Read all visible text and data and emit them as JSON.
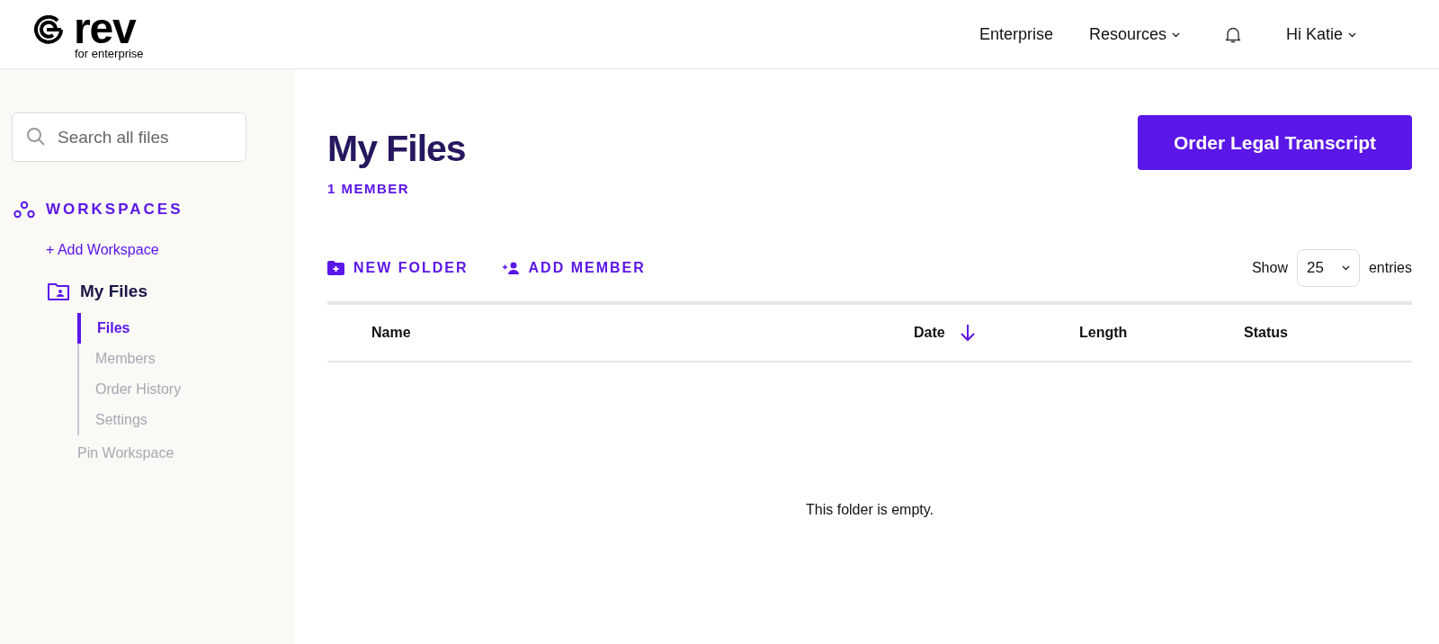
{
  "header": {
    "logo": {
      "wordmark": "rev",
      "tagline": "for enterprise"
    },
    "nav": [
      {
        "label": "Enterprise",
        "dropdown": false
      },
      {
        "label": "Resources",
        "dropdown": true
      },
      {
        "kind": "bell"
      },
      {
        "label": "Hi Katie",
        "dropdown": true
      }
    ]
  },
  "sidebar": {
    "search": {
      "placeholder": "Search all files"
    },
    "section_title": "WORKSPACES",
    "add_link": "+ Add Workspace",
    "workspace": {
      "name": "My Files",
      "items": [
        {
          "label": "Files",
          "selected": true
        },
        {
          "label": "Members",
          "selected": false
        },
        {
          "label": "Order History",
          "selected": false
        },
        {
          "label": "Settings",
          "selected": false
        }
      ]
    },
    "pin_link": "Pin Workspace"
  },
  "main": {
    "title": "My Files",
    "subtitle": "1 MEMBER",
    "primary_button": "Order Legal Transcript",
    "actions": [
      {
        "kind": "folder",
        "label": "NEW FOLDER"
      },
      {
        "kind": "member",
        "label": "ADD MEMBER"
      }
    ],
    "entries": {
      "before": "Show",
      "value": "25",
      "after": "entries"
    },
    "table": {
      "columns": [
        {
          "label": "Name",
          "sorted": false
        },
        {
          "label": "Date",
          "sorted": true
        },
        {
          "label": "Length",
          "sorted": false
        },
        {
          "label": "Status",
          "sorted": false
        }
      ],
      "empty_message": "This folder is empty."
    }
  }
}
